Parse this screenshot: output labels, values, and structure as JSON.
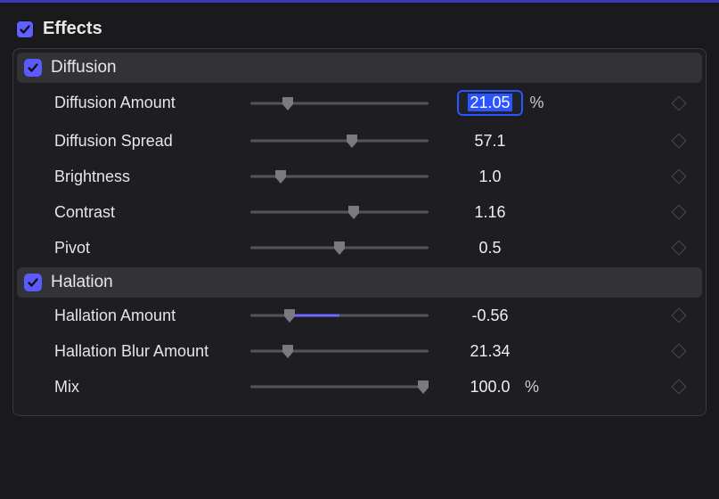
{
  "header": {
    "title": "Effects"
  },
  "sections": {
    "diffusion": {
      "title": "Diffusion",
      "params": {
        "amount": {
          "label": "Diffusion Amount",
          "value": "21.05",
          "unit": "%"
        },
        "spread": {
          "label": "Diffusion  Spread",
          "value": "57.1",
          "unit": ""
        },
        "brightness": {
          "label": "Brightness",
          "value": "1.0",
          "unit": ""
        },
        "contrast": {
          "label": "Contrast",
          "value": "1.16",
          "unit": ""
        },
        "pivot": {
          "label": "Pivot",
          "value": "0.5",
          "unit": ""
        }
      }
    },
    "halation": {
      "title": "Halation",
      "params": {
        "amount": {
          "label": "Hallation Amount",
          "value": "-0.56",
          "unit": ""
        },
        "blur": {
          "label": "Hallation Blur Amount",
          "value": "21.34",
          "unit": ""
        },
        "mix": {
          "label": "Mix",
          "value": "100.0",
          "unit": "%"
        }
      }
    }
  }
}
